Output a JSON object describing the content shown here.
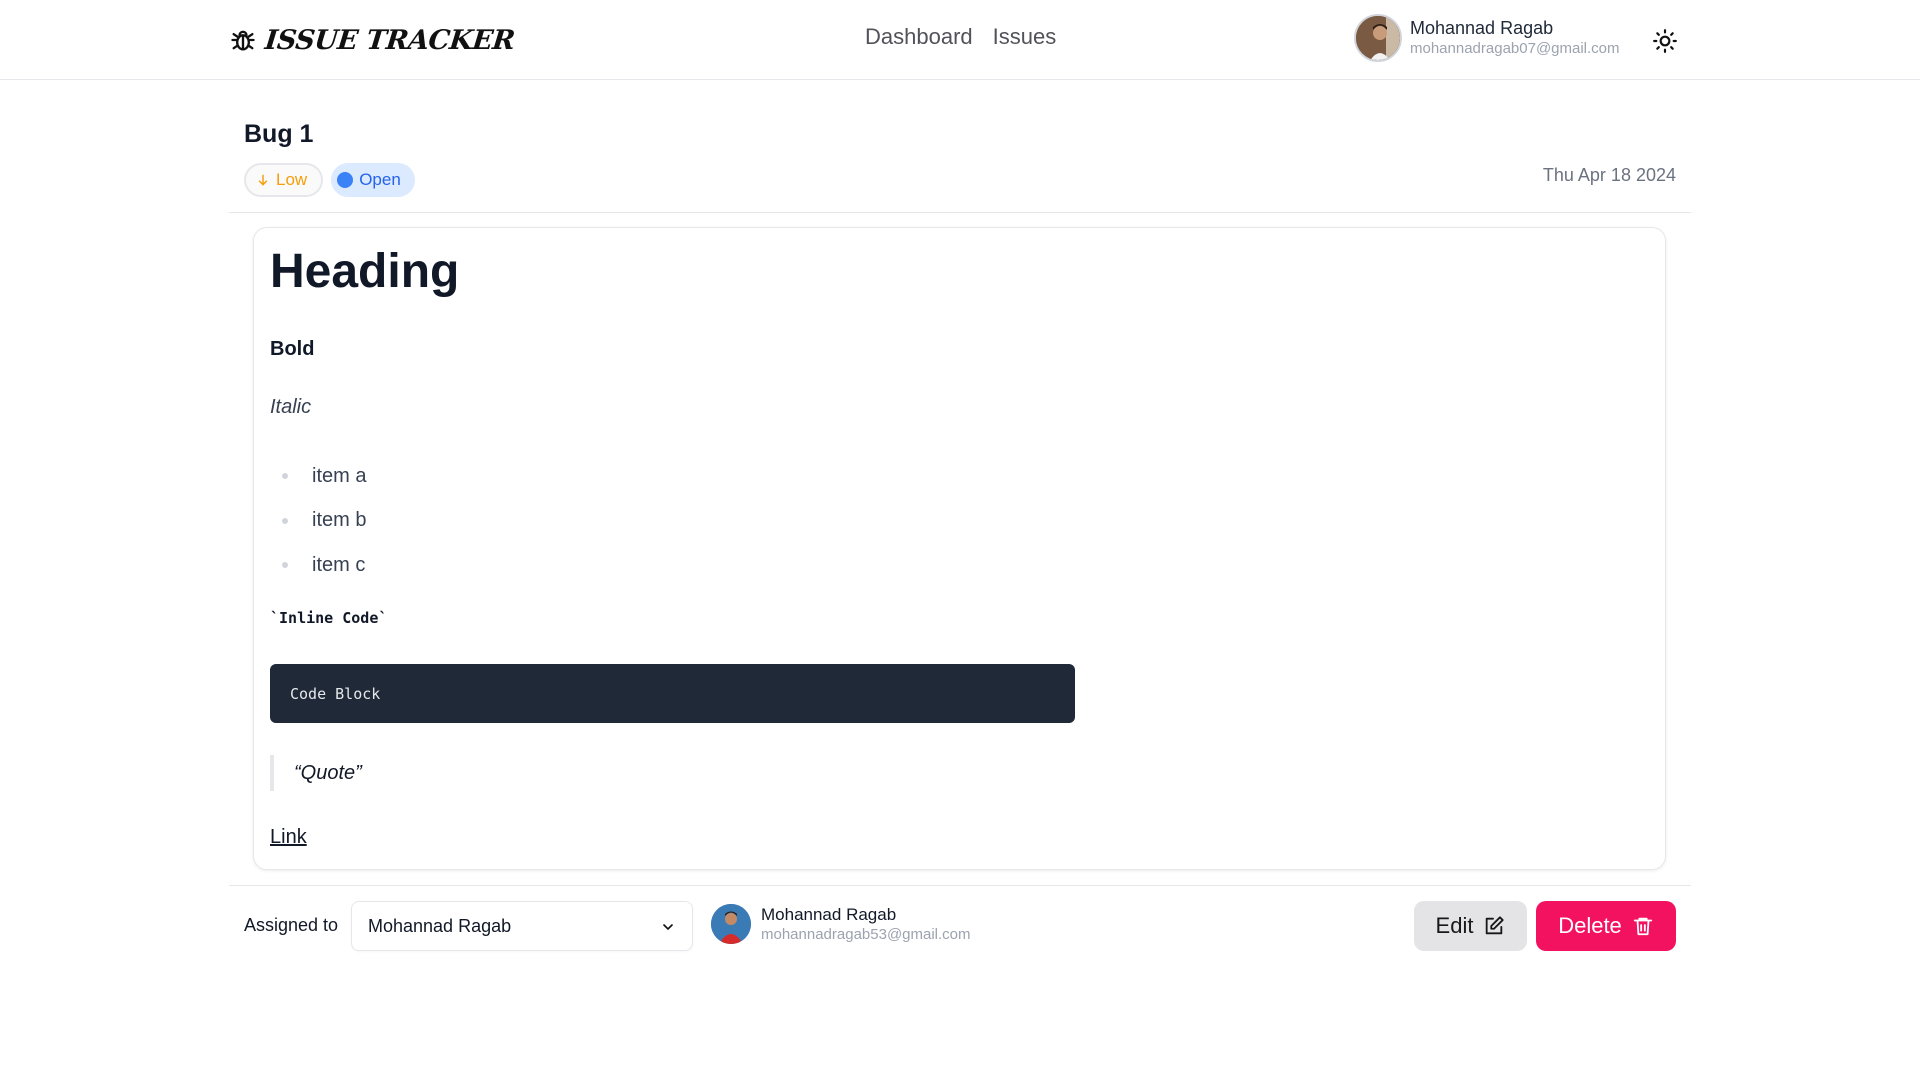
{
  "navbar": {
    "logo_text": "ISSUE TRACKER",
    "links": [
      "Dashboard",
      "Issues"
    ],
    "user": {
      "name": "Mohannad Ragab",
      "email": "mohannadragab07@gmail.com"
    }
  },
  "issue": {
    "title": "Bug 1",
    "priority": "Low",
    "status": "Open",
    "date": "Thu Apr 18 2024"
  },
  "content": {
    "heading": "Heading",
    "bold": "Bold",
    "italic": "Italic",
    "list": [
      "item a",
      "item b",
      "item c"
    ],
    "inline_code": "`Inline Code`",
    "code_block": "Code Block",
    "quote": "“Quote”",
    "link": "Link"
  },
  "footer": {
    "assign_label": "Assigned to",
    "selected_assignee": "Mohannad Ragab",
    "assignee": {
      "name": "Mohannad Ragab",
      "email": "mohannadragab53@gmail.com"
    },
    "edit_label": "Edit",
    "delete_label": "Delete"
  },
  "colors": {
    "delete_button": "#f31260",
    "status_open": "#3b82f6",
    "priority_low": "#f59e0b"
  },
  "icons": [
    "bug-icon",
    "sun-icon",
    "arrow-down-icon",
    "chevron-down-icon",
    "edit-icon",
    "trash-icon"
  ]
}
